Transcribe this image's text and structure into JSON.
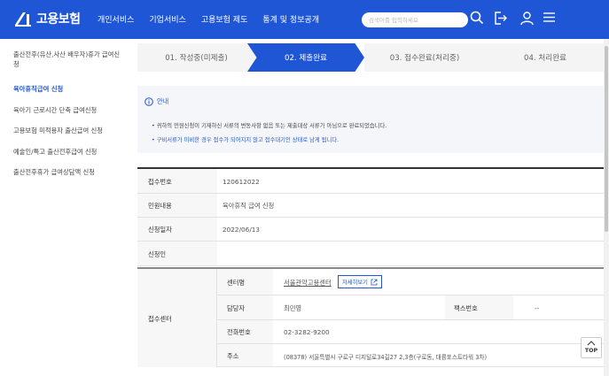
{
  "header": {
    "logo_text": "고용보험",
    "nav": [
      "개인서비스",
      "기업서비스",
      "고용보험 제도",
      "통계 및 정보공개"
    ],
    "search_placeholder": "검색어를 입력하세요",
    "brand_color": "#1f56d6"
  },
  "sidebar": {
    "items": [
      {
        "label": "출산전후(유산,사산 배우자)휴가 급여신청",
        "active": false
      },
      {
        "label": "육아휴직급여 신청",
        "active": true
      },
      {
        "label": "육아기 근로시간 단축 급여신청",
        "active": false
      },
      {
        "label": "고용보험 미적용자 출산급여 신청",
        "active": false
      },
      {
        "label": "예술인/특고 출산전후급여 신청",
        "active": false
      },
      {
        "label": "출산전후휴가 급여상담액 신청",
        "active": false
      }
    ]
  },
  "steps": [
    {
      "label": "01. 작성중(미제출)",
      "active": false
    },
    {
      "label": "02. 제출완료",
      "active": true
    },
    {
      "label": "03. 접수완료(처리중)",
      "active": false
    },
    {
      "label": "04. 처리완료",
      "active": false
    }
  ],
  "notice": {
    "title": "안내",
    "lines": [
      "• 귀하의 민원신청이 기재하신 서류의 변동사항 없음 또는 제출대상 서류가 아님으로 완료되었습니다.",
      "• 구비서류가 미비한 경우 접수가 되어지지 않고 접수대기인 상태로 남게 됩니다."
    ]
  },
  "info": {
    "rows": [
      {
        "label": "접수번호",
        "value": "120612022"
      },
      {
        "label": "민원내용",
        "value": "육아휴직 급여 신청"
      },
      {
        "label": "신청일자",
        "value": "2022/06/13"
      },
      {
        "label": "신청인",
        "value": ""
      }
    ]
  },
  "center": {
    "label": "접수센터",
    "center_name_label": "센터명",
    "center_name": "서울관악고용센터",
    "detail_button": "자세히보기",
    "manager_label": "담당자",
    "manager": "최민영",
    "fax_label": "팩스번호",
    "fax": "--",
    "phone_label": "전화번호",
    "phone": "02-3282-9200",
    "address_label": "주소",
    "address": "(08378) 서울특별시 구로구 디지털로34길27 2,3층(구로동, 대륭포스트타워 3차)"
  },
  "top_button": "TOP"
}
